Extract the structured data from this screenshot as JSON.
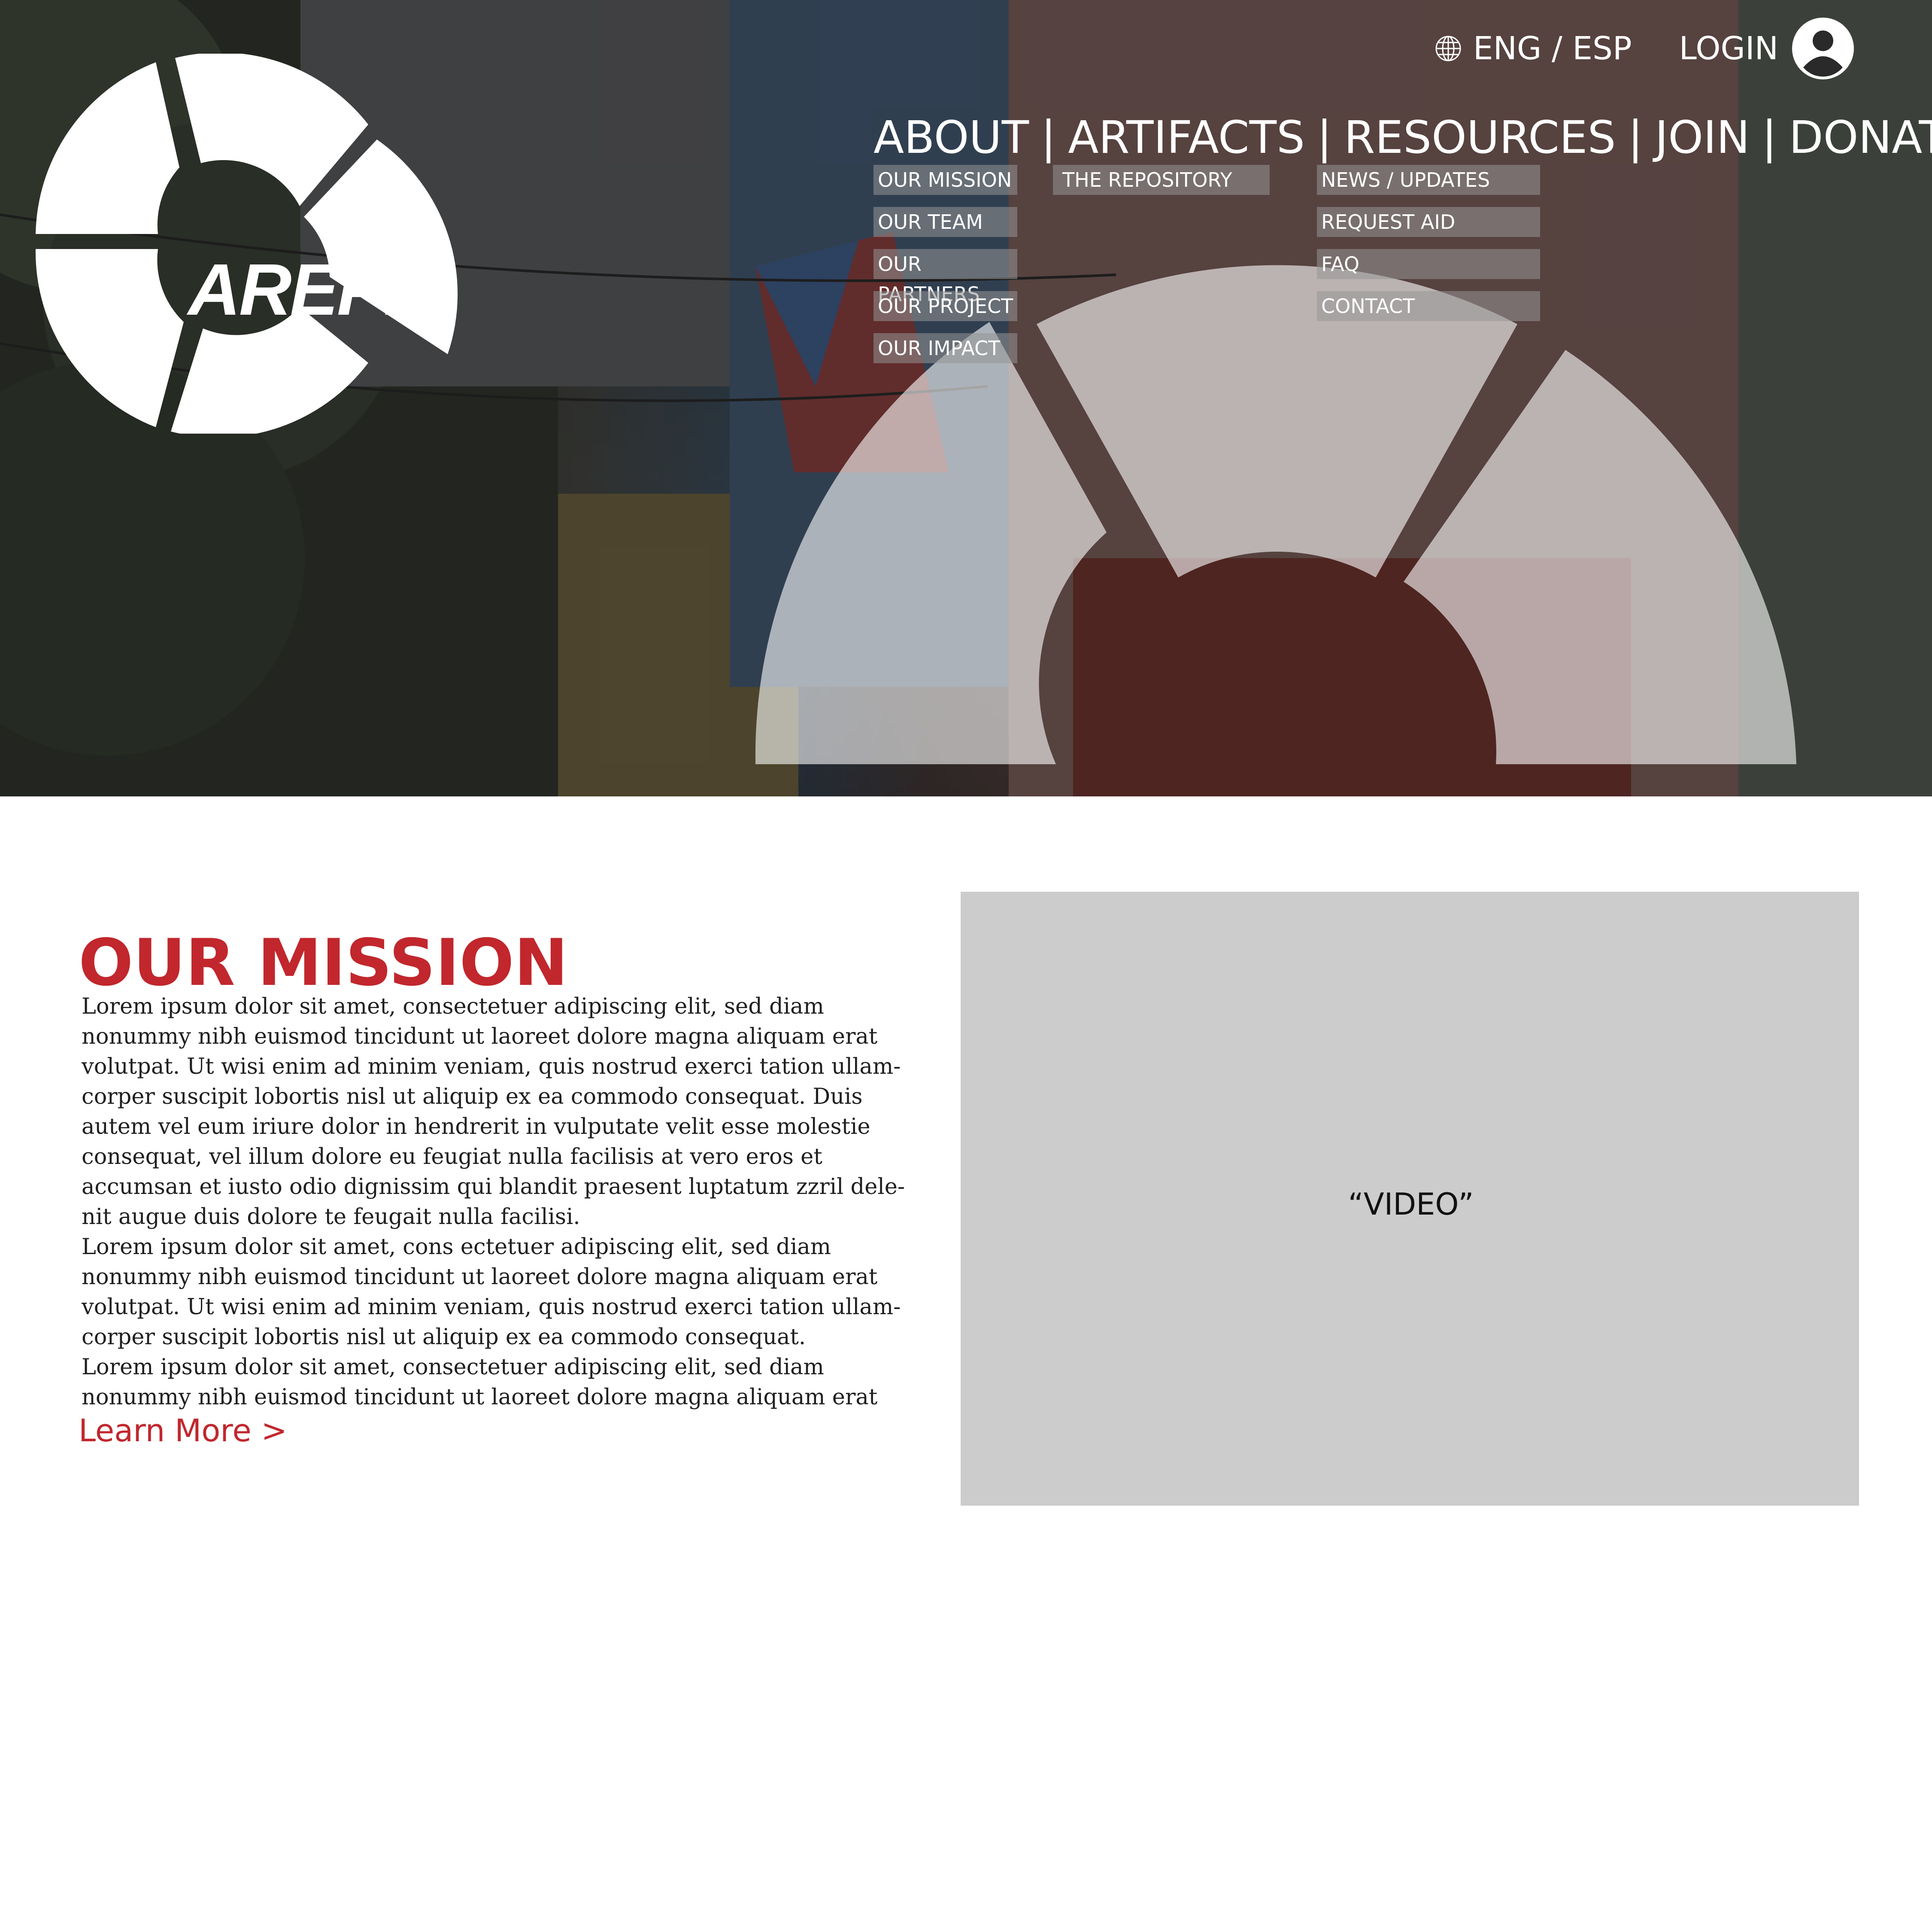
{
  "header": {
    "logo_text": "AREPR",
    "language_switch": "ENG / ESP",
    "login_label": "LOGIN",
    "icons": {
      "language": "globe-icon",
      "login": "user-avatar-icon"
    }
  },
  "nav": {
    "separator": "|",
    "items": [
      {
        "label": "ABOUT"
      },
      {
        "label": "ARTIFACTS"
      },
      {
        "label": "RESOURCES"
      },
      {
        "label": "JOIN"
      },
      {
        "label": "DONATE"
      }
    ],
    "submenus": {
      "about": [
        "OUR MISSION",
        "OUR TEAM",
        "OUR PARTNERS",
        "OUR PROJECT",
        "OUR IMPACT"
      ],
      "artifacts": [
        "THE REPOSITORY"
      ],
      "resources": [
        "NEWS / UPDATES",
        "REQUEST AID",
        "FAQ",
        "CONTACT"
      ]
    }
  },
  "mission": {
    "title": "OUR MISSION",
    "paragraphs": [
      "Lorem ipsum dolor sit amet, consectetuer adipiscing elit, sed diam nonummy nibh euismod tincidunt ut laoreet dolore magna aliquam erat volutpat. Ut wisi enim ad minim veniam, quis nostrud exerci tation ullam-corper suscipit lobortis nisl ut aliquip ex ea commodo consequat. Duis autem vel eum iriure dolor in hendrerit in vulputate velit esse molestie consequat, vel illum dolore eu feugiat nulla facilisis at vero eros et accumsan et iusto odio dignissim qui blandit praesent luptatum zzril dele-nit augue duis dolore te feugait nulla facilisi.",
      "Lorem ipsum dolor sit amet, cons ectetuer adipiscing elit, sed diam nonummy nibh euismod tincidunt ut laoreet dolore magna aliquam erat volutpat. Ut wisi enim ad minim veniam, quis nostrud exerci tation ullam-corper suscipit lobortis nisl ut aliquip ex ea commodo consequat.",
      "Lorem ipsum dolor sit amet, consectetuer adipiscing elit, sed diam nonummy nibh euismod tincidunt ut laoreet dolore magna aliquam erat"
    ],
    "learn_more": "Learn More >"
  },
  "video": {
    "label": "“VIDEO”"
  },
  "colors": {
    "accent": "#c1272d",
    "video_bg": "#cccccc",
    "submenu_bg": "#969696"
  }
}
